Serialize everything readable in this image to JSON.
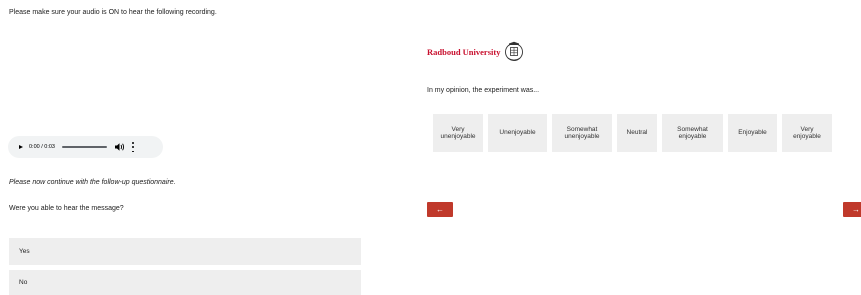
{
  "left": {
    "notice": "Please make sure your audio is ON to hear the following recording.",
    "player": {
      "time": "0:00 / 0:03",
      "play_icon": "play-icon",
      "volume_icon": "volume-icon",
      "more_icon": "more-options-icon"
    },
    "continue_text": "Please now continue with the follow-up questionnaire.",
    "question": "Were you able to hear the message?",
    "options": [
      "Yes",
      "No"
    ]
  },
  "right": {
    "logo_text": "Radboud University",
    "prompt": "In my opinion, the experiment was...",
    "scale": [
      "Very unenjoyable",
      "Unenjoyable",
      "Somewhat unenjoyable",
      "Neutral",
      "Somewhat enjoyable",
      "Enjoyable",
      "Very enjoyable"
    ],
    "back_label": "←",
    "next_label": "→"
  },
  "colors": {
    "brand": "#c8102e",
    "button": "#c0392b",
    "option_bg": "#eeeeee",
    "player_bg": "#f1f3f4"
  }
}
